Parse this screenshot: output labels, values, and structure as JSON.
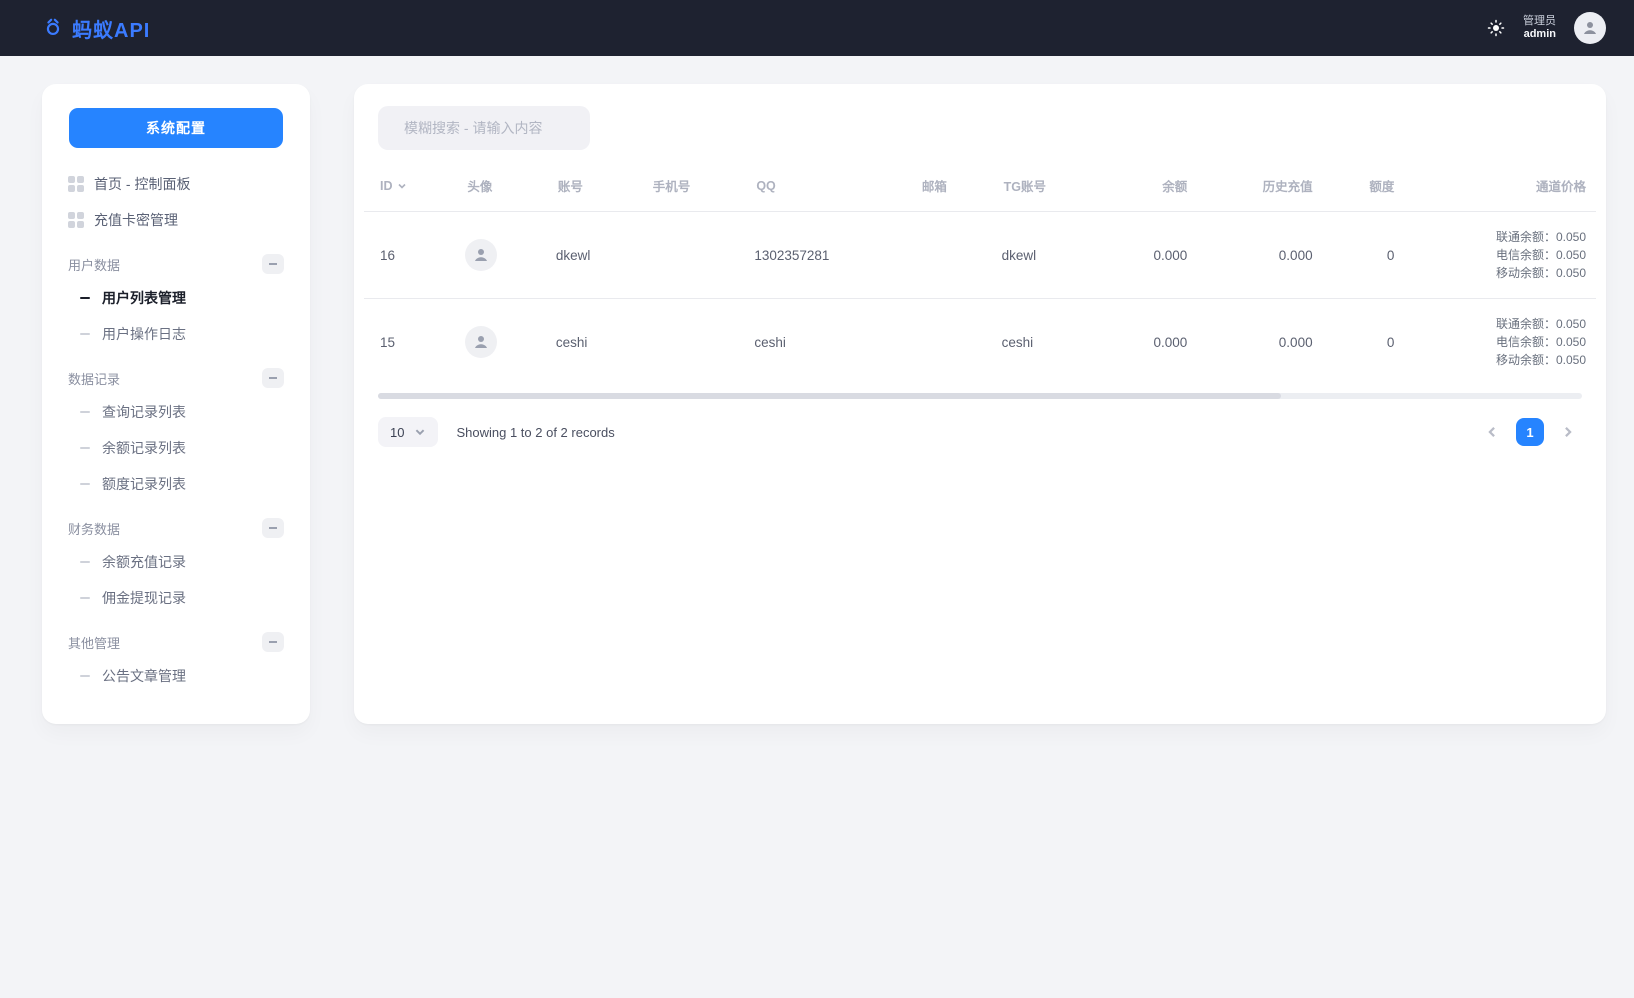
{
  "brand": {
    "name": "蚂蚁API"
  },
  "header": {
    "role_label": "管理员",
    "username": "admin"
  },
  "sidebar": {
    "sysconfig_btn": "系统配置",
    "flat_items": [
      {
        "label": "首页 - 控制面板"
      },
      {
        "label": "充值卡密管理"
      }
    ],
    "groups": [
      {
        "title": "用户数据",
        "items": [
          {
            "label": "用户列表管理",
            "active": true
          },
          {
            "label": "用户操作日志"
          }
        ]
      },
      {
        "title": "数据记录",
        "items": [
          {
            "label": "查询记录列表"
          },
          {
            "label": "余额记录列表"
          },
          {
            "label": "额度记录列表"
          }
        ]
      },
      {
        "title": "财务数据",
        "items": [
          {
            "label": "余额充值记录"
          },
          {
            "label": "佣金提现记录"
          }
        ]
      },
      {
        "title": "其他管理",
        "items": [
          {
            "label": "公告文章管理"
          }
        ]
      }
    ]
  },
  "search": {
    "placeholder": "模糊搜索 - 请输入内容"
  },
  "table": {
    "columns": {
      "id": "ID",
      "avatar": "头像",
      "account": "账号",
      "phone": "手机号",
      "qq": "QQ",
      "email": "邮箱",
      "tg": "TG账号",
      "balance": "余额",
      "history": "历史充值",
      "quota": "额度",
      "channel_price": "通道价格"
    },
    "rows": [
      {
        "id": "16",
        "account": "dkewl",
        "phone": "",
        "qq": "1302357281",
        "email": "",
        "tg": "dkewl",
        "balance": "0.000",
        "history": "0.000",
        "quota": "0",
        "channel": {
          "l1": "联通余额：0.050",
          "l2": "电信余额：0.050",
          "l3": "移动余额：0.050"
        }
      },
      {
        "id": "15",
        "account": "ceshi",
        "phone": "",
        "qq": "ceshi",
        "email": "",
        "tg": "ceshi",
        "balance": "0.000",
        "history": "0.000",
        "quota": "0",
        "channel": {
          "l1": "联通余额：0.050",
          "l2": "电信余额：0.050",
          "l3": "移动余额：0.050"
        }
      }
    ]
  },
  "pagination": {
    "page_size": "10",
    "records_text": "Showing 1 to 2 of 2 records",
    "current_page": "1"
  }
}
